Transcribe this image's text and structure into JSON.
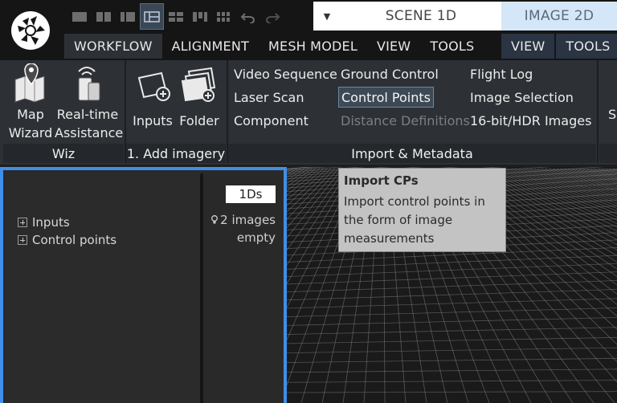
{
  "toolbar": {
    "layout_icons": [
      "layout-1-icon",
      "layout-2-icon",
      "layout-3-icon",
      "layout-4-icon",
      "layout-5-icon",
      "layout-6-icon",
      "layout-7-icon",
      "undo-icon",
      "redo-icon"
    ]
  },
  "tabs": {
    "scene": "SCENE 1D",
    "image": "IMAGE 2D",
    "dropdown_glyph": "▼"
  },
  "menu": {
    "workflow": "WORKFLOW",
    "alignment": "ALIGNMENT",
    "mesh_model": "MESH MODEL",
    "view": "VIEW",
    "tools": "TOOLS",
    "view_2": "VIEW",
    "tools_2": "TOOLS"
  },
  "ribbon": {
    "map_wizard": {
      "line1": "Map",
      "line2": "Wizard"
    },
    "realtime": {
      "line1": "Real-time",
      "line2": "Assistance"
    },
    "inputs": "Inputs",
    "folder": "Folder",
    "video_sequence": "Video Sequence",
    "laser_scan": "Laser Scan",
    "component": "Component",
    "ground_control": "Ground Control",
    "control_points": "Control Points",
    "distance_definitions": "Distance Definitions",
    "flight_log": "Flight Log",
    "image_selection": "Image Selection",
    "hdr_images": "16-bit/HDR Images",
    "cut_text": "S",
    "groups": {
      "wiz": "Wiz",
      "add_imagery": "1. Add imagery",
      "import_metadata": "Import & Metadata"
    }
  },
  "panel": {
    "tree": [
      "Inputs",
      "Control points"
    ],
    "badge": "1Ds",
    "images": "2 images",
    "empty": "empty"
  },
  "tooltip": {
    "title": "Import CPs",
    "line1": "Import control points in",
    "line2": "the form of image",
    "line3": "measurements"
  },
  "colors": {
    "accent_blue": "#3f8fe7",
    "image_tab": "#d4e7f8",
    "ribbon_bg": "#2d3035",
    "tooltip_bg": "#c3c3c3"
  }
}
